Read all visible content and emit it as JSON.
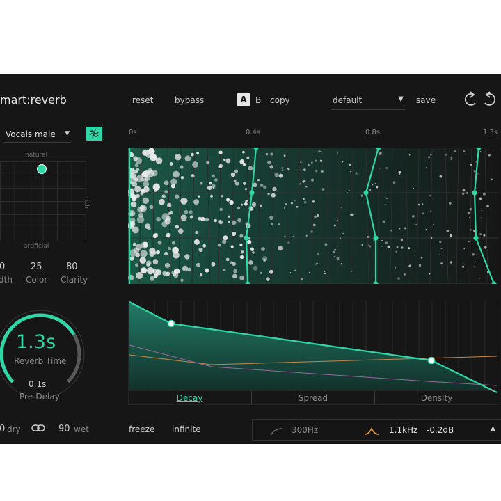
{
  "app": {
    "title": "mart:reverb"
  },
  "header": {
    "reset_label": "reset",
    "bypass_label": "bypass",
    "ab_a_label": "A",
    "ab_b_label": "B",
    "copy_label": "copy",
    "preset_value": "default",
    "save_label": "save"
  },
  "profile": {
    "value": "Vocals male"
  },
  "character_pad": {
    "top_label": "natural",
    "bottom_label": "artificial",
    "right_label": "rich"
  },
  "params": [
    {
      "value": "0",
      "label": "dth"
    },
    {
      "value": "25",
      "label": "Color"
    },
    {
      "value": "80",
      "label": "Clarity"
    }
  ],
  "reverb_knob": {
    "value": "1.3s",
    "label": "Reverb Time",
    "level": 0.72,
    "predelay_value": "0.1s",
    "predelay_label": "Pre-Delay"
  },
  "mix": {
    "dry_value": "0",
    "dry_label": "dry",
    "wet_value": "90",
    "wet_label": "wet"
  },
  "timeline": {
    "ticks": [
      "0s",
      "0.4s",
      "0.8s",
      "1.3s"
    ]
  },
  "tabs": [
    "Decay",
    "Spread",
    "Density"
  ],
  "active_tab": "Decay",
  "footer": {
    "freeze_label": "freeze",
    "infinite_label": "infinite",
    "lowcut_value": "300Hz",
    "eq_freq_value": "1.1kHz",
    "eq_gain_value": "-0.2dB"
  },
  "colors": {
    "accent": "#2fd7a7",
    "background": "#161616",
    "orange": "#e8933f"
  }
}
